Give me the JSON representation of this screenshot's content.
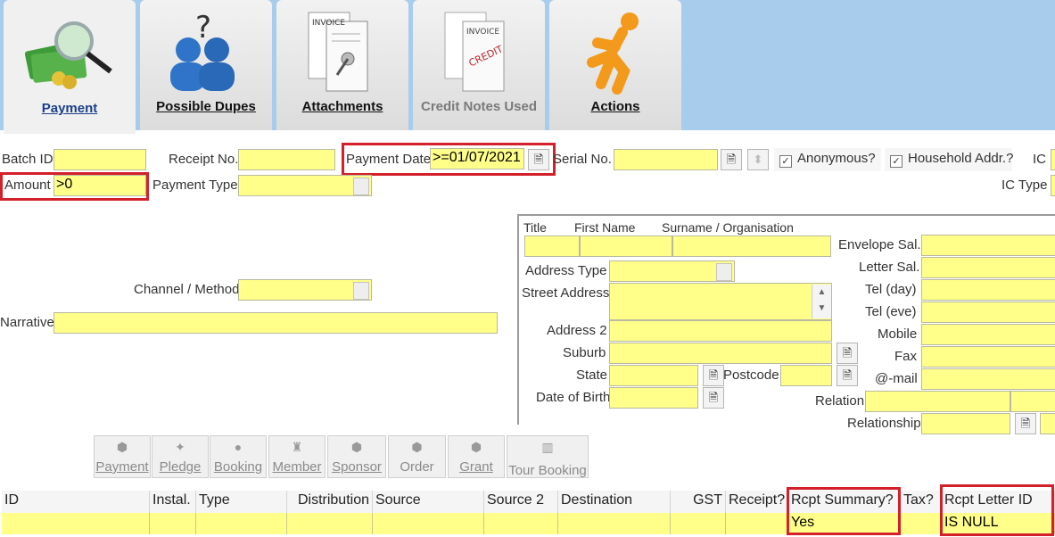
{
  "tabs": [
    {
      "label": "Payment",
      "icon": "payment-money-icon",
      "state": "active"
    },
    {
      "label": "Possible Dupes",
      "icon": "people-question-icon",
      "state": "normal"
    },
    {
      "label": "Attachments",
      "icon": "attachment-document-icon",
      "state": "normal"
    },
    {
      "label": "Credit Notes Used",
      "icon": "credit-invoice-icon",
      "state": "disabled"
    },
    {
      "label": "Actions",
      "icon": "running-person-icon",
      "state": "normal"
    }
  ],
  "payment": {
    "batch_id_label": "Batch ID",
    "batch_id_value": "",
    "receipt_no_label": "Receipt No.",
    "receipt_no_value": "",
    "payment_date_label": "Payment Date",
    "payment_date_value": ">=01/07/2021",
    "serial_no_label": "Serial No.",
    "serial_no_value": "",
    "anonymous_label": "Anonymous?",
    "household_label": "Household Addr.?",
    "ic_label": "IC",
    "ic_type_label": "IC Type",
    "amount_label": "Amount",
    "amount_value": ">0",
    "payment_type_label": "Payment Type",
    "payment_type_value": "",
    "channel_label": "Channel / Method",
    "channel_value": "",
    "narrative_label": "Narrative",
    "narrative_value": ""
  },
  "contact": {
    "title_label": "Title",
    "first_name_label": "First Name",
    "surname_label": "Surname / Organisation",
    "address_type_label": "Address Type",
    "street_label": "Street Address",
    "address2_label": "Address 2",
    "suburb_label": "Suburb",
    "state_label": "State",
    "postcode_label": "Postcode",
    "dob_label": "Date of Birth",
    "relation_label": "Relation",
    "relationship_label": "Relationship",
    "envelope_label": "Envelope Sal.",
    "letter_label": "Letter Sal.",
    "tel_day_label": "Tel (day)",
    "tel_eve_label": "Tel (eve)",
    "mobile_label": "Mobile",
    "fax_label": "Fax",
    "email_label": "@-mail"
  },
  "actions": [
    {
      "label": "Payment",
      "icon": "payment-icon"
    },
    {
      "label": "Pledge",
      "icon": "pledge-icon"
    },
    {
      "label": "Booking",
      "icon": "booking-icon"
    },
    {
      "label": "Member",
      "icon": "member-icon"
    },
    {
      "label": "Sponsor",
      "icon": "sponsor-icon"
    },
    {
      "label": "Order",
      "icon": "order-icon"
    },
    {
      "label": "Grant",
      "icon": "grant-icon"
    },
    {
      "label": "Tour Booking",
      "icon": "tour-booking-icon"
    }
  ],
  "grid": {
    "headers": [
      "ID",
      "Instal.",
      "Type",
      "Distribution",
      "Source",
      "Source 2",
      "Destination",
      "GST",
      "Receipt?",
      "Rcpt Summary?",
      "Tax?",
      "Rcpt Letter ID"
    ],
    "row": [
      "",
      "",
      "",
      "",
      "",
      "",
      "",
      "",
      "",
      "Yes",
      "",
      "IS NULL"
    ]
  },
  "colors": {
    "field_yellow": "#ffff8a",
    "highlight_red": "#d4202a",
    "tab_strip_blue": "#a8ccec",
    "active_tab_label": "#1a3f8c"
  }
}
